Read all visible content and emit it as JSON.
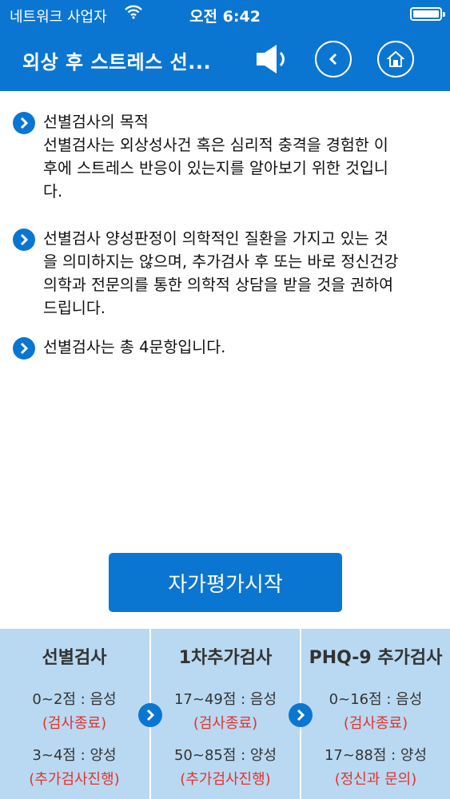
{
  "status_bar": {
    "carrier": "네트워크 사업자",
    "time": "오전 6:42"
  },
  "navbar": {
    "title": "외상 후 스트레스 선...",
    "icons": [
      "speaker-icon",
      "back-icon",
      "home-icon"
    ],
    "accent": "#0b76d1"
  },
  "content": {
    "items": [
      {
        "text": "선별검사의 목적\n선별검사는 외상성사건 혹은 심리적 충격을 경험한 이\n후에 스트레스 반응이 있는지를 알아보기 위한 것입니\n다."
      },
      {
        "text": "선별검사 양성판정이 의학적인 질환을 가지고 있는 것\n을 의미하지는 않으며, 추가검사 후 또는 바로 정신건강\n의학과 전문의를 통한 의학적 상담을 받을 것을 권하여\n드립니다."
      },
      {
        "text": "선별검사는 총 4문항입니다."
      }
    ]
  },
  "start_button": {
    "label": "자가평가시작"
  },
  "bottom_panel": {
    "columns": [
      {
        "title": "선별검사",
        "a": "0~2점 : 음성",
        "b": "(검사종료)",
        "c": "3~4점 : 양성",
        "d": "(추가검사진행)"
      },
      {
        "title": "1차추가검사",
        "a": "17~49점 : 음성",
        "b": "(검사종료)",
        "c": "50~85점 : 양성",
        "d": "(추가검사진행)"
      },
      {
        "title": "PHQ-9 추가검사",
        "a": "0~16점 : 음성",
        "b": "(검사종료)",
        "c": "17~88점 : 양성",
        "d": "(정신과 문의)"
      }
    ],
    "colors": {
      "panel": "#b9d9f2",
      "warning": "#e4322b"
    }
  }
}
